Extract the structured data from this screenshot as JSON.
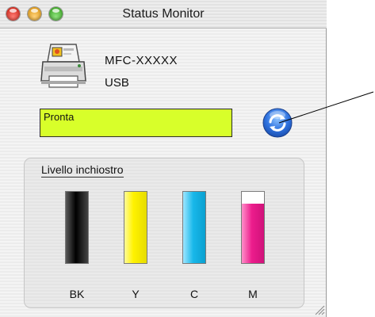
{
  "window": {
    "title": "Status Monitor"
  },
  "device": {
    "model": "MFC-XXXXX",
    "connection": "USB"
  },
  "status": {
    "text": "Pronta",
    "color": "#d8ff2a"
  },
  "ink": {
    "title": "Livello inchiostro",
    "cartridges": [
      {
        "label": "BK",
        "level": 1.0,
        "color": "#000000"
      },
      {
        "label": "Y",
        "level": 1.0,
        "color": "#fff200"
      },
      {
        "label": "C",
        "level": 1.0,
        "color": "#18b8ea"
      },
      {
        "label": "M",
        "level": 0.83,
        "color": "#ec1c8c"
      }
    ]
  },
  "icons": {
    "printer": "printer-icon",
    "refresh": "refresh-icon"
  }
}
